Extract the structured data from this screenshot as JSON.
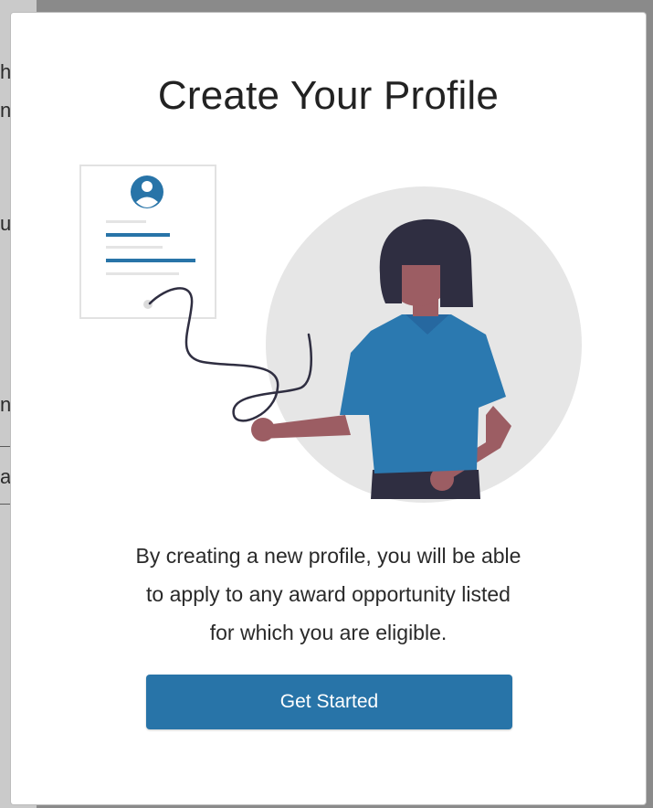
{
  "modal": {
    "title": "Create Your Profile",
    "description_lines": [
      "By creating a new profile, you will be able",
      "to apply to any award opportunity listed",
      "for which you are eligible."
    ],
    "cta_label": "Get Started"
  },
  "background_page": {
    "fragments": [
      "h",
      "n",
      "u",
      "n",
      "a"
    ]
  },
  "illustration": {
    "type": "woman-signing-document",
    "icons": [
      "user-avatar-icon"
    ]
  },
  "colors": {
    "accent": "#2874a8",
    "overlay": "#8a8a8a",
    "circle": "#e6e6e6",
    "shirt": "#2b79b0",
    "skin": "#9c5d63",
    "hair": "#2f2e41"
  }
}
